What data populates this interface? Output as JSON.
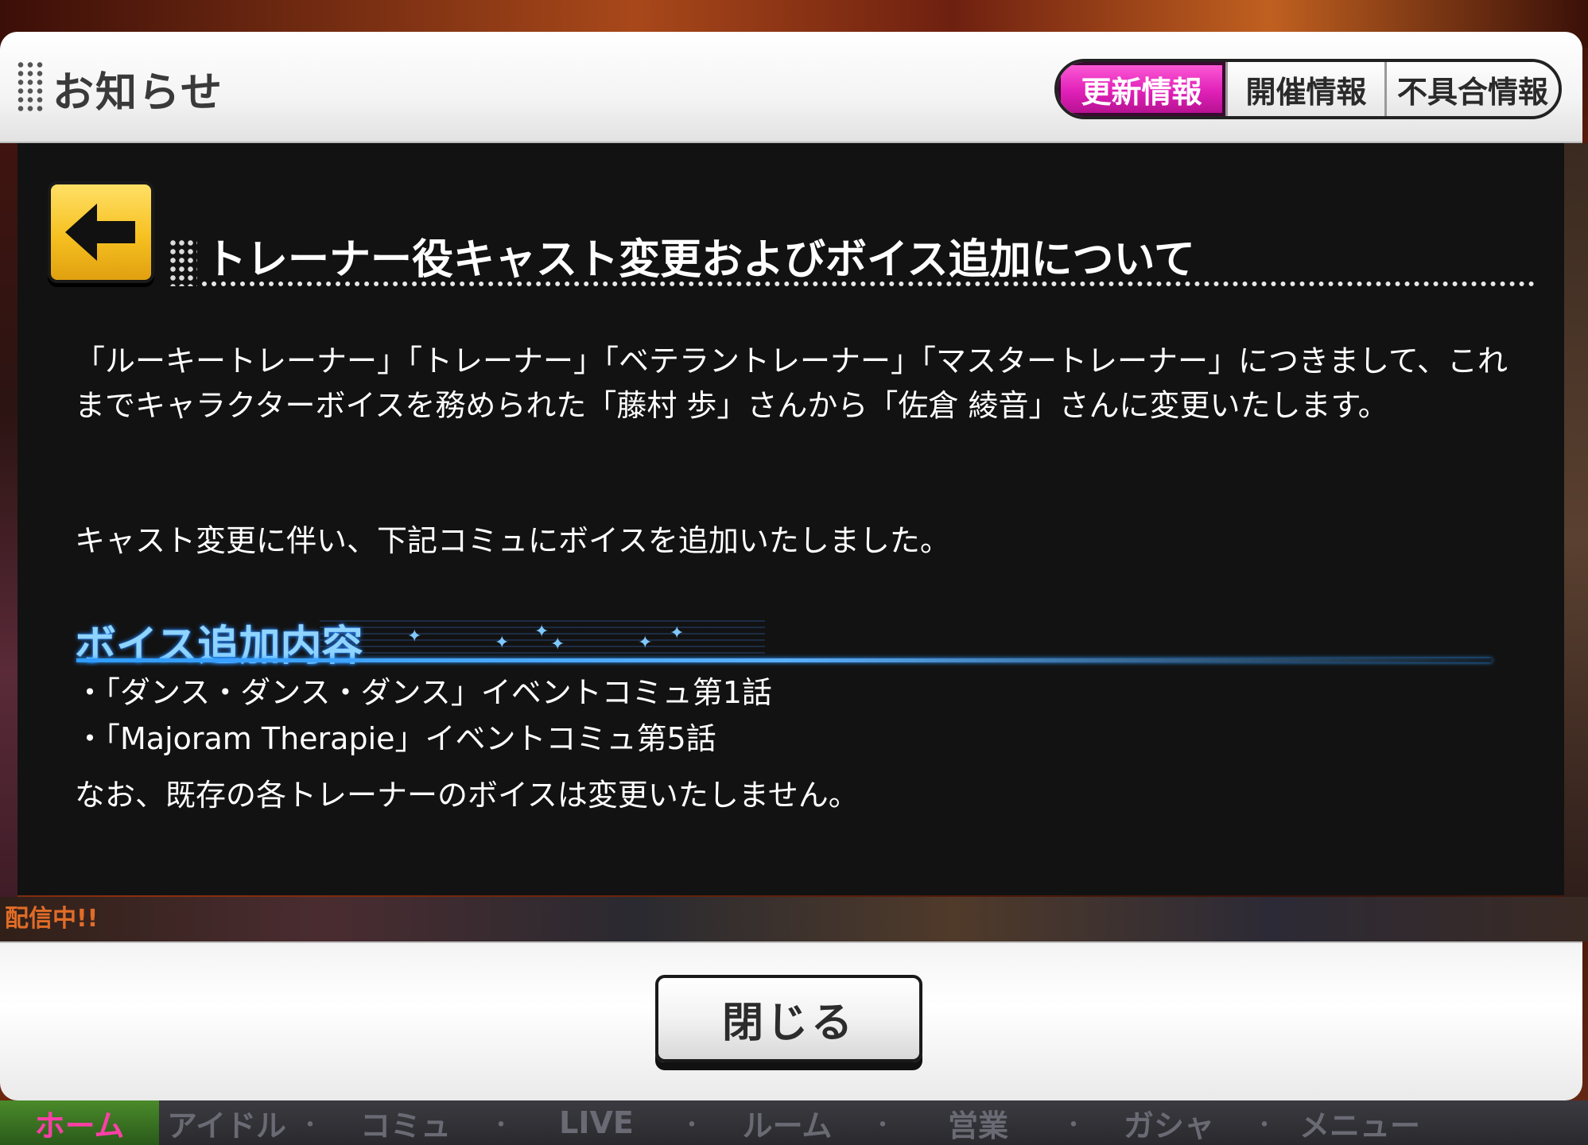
{
  "header": {
    "title": "お知らせ",
    "tabs": [
      {
        "label": "更新情報",
        "active": true
      },
      {
        "label": "開催情報",
        "active": false
      },
      {
        "label": "不具合情報",
        "active": false
      }
    ]
  },
  "notice": {
    "title": "トレーナー役キャスト変更およびボイス追加について",
    "paragraph1": "「ルーキートレーナー」「トレーナー」「ベテラントレーナー」「マスタートレーナー」につきまして、これまでキャラクターボイスを務められた「藤村 歩」さんから「佐倉 綾音」さんに変更いたします。",
    "paragraph2": "キャスト変更に伴い、下記コミュにボイスを追加いたしました。",
    "section_heading": "ボイス追加内容",
    "voice_items": [
      "・「ダンス・ダンス・ダンス」イベントコミュ第1話",
      "・「Majoram Therapie」イベントコミュ第5話"
    ],
    "note": "なお、既存の各トレーナーのボイスは変更いたしません。"
  },
  "footer": {
    "close_label": "閉じる"
  },
  "bottom_nav": {
    "items": [
      "ホーム",
      "アイドル",
      "コミュ",
      "LIVE",
      "ルーム",
      "営業",
      "ガシャ",
      "メニュー"
    ]
  },
  "background": {
    "strip_text": "配信中!!"
  },
  "colors": {
    "active_tab": "#e020b8",
    "panel_bg": "#121212",
    "back_button": "#f6c020",
    "section_heading": "#8fd4ff"
  }
}
